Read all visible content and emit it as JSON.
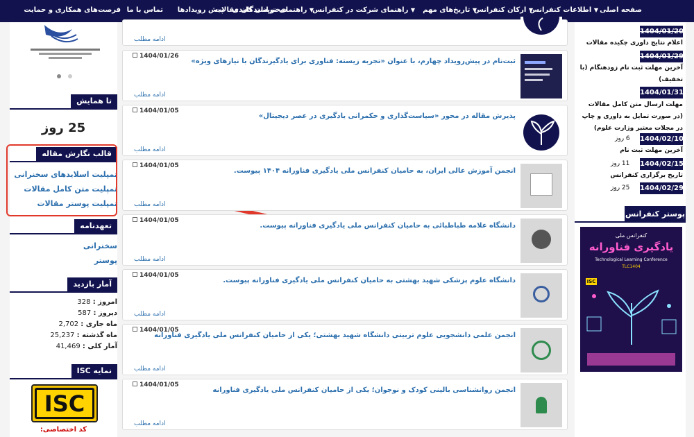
{
  "nav": [
    {
      "label": "صفحه اصلی",
      "dropdown": false
    },
    {
      "label": "اطلاعات کنفرانس",
      "dropdown": true
    },
    {
      "label": "ارکان کنفرانس",
      "dropdown": true
    },
    {
      "label": "تاریخ‌های مهم",
      "dropdown": true
    },
    {
      "label": "راهنمای شرکت در کنفرانس",
      "dropdown": true
    },
    {
      "label": "راهنمای نویسندگان مقالات",
      "dropdown": true
    },
    {
      "label": "سخنرانان کلیدی",
      "dropdown": false
    },
    {
      "label": "پیش رویدادها",
      "dropdown": false
    },
    {
      "label": "تماس با ما",
      "dropdown": false
    },
    {
      "label": "فرصت‌های همکاری و حمایت",
      "dropdown": false
    }
  ],
  "left": {
    "countdown": {
      "title": "تا همایش",
      "value": "25 روز"
    },
    "template": {
      "title": "قالب نگارش مقاله",
      "links": [
        "تمپلیت اسلایدهای سخنرانی",
        "تمپلیت متن کامل مقالات",
        "تمپلیت پوستر مقالات"
      ]
    },
    "commitment": {
      "title": "تعهدنامه",
      "links": [
        "سخنرانی",
        "پوستر"
      ]
    },
    "stats": {
      "title": "آمار بازدید",
      "rows": [
        {
          "label": "امروز :",
          "value": "328"
        },
        {
          "label": "دیروز :",
          "value": "587"
        },
        {
          "label": "ماه جاری :",
          "value": "2,702"
        },
        {
          "label": "ماه گذشته :",
          "value": "25,237"
        },
        {
          "label": "آمار کلی :",
          "value": "41,469"
        }
      ]
    },
    "isc": {
      "title": "نمایه ISC",
      "logo_text": "ISC",
      "code_label": "کد اختصاصی:"
    }
  },
  "news": {
    "more_label": "ادامه مطلب",
    "items": [
      {
        "date": "",
        "title": ""
      },
      {
        "date": "1404/01/26",
        "title": "ثبت‌نام در پیش‌رویداد چهارم، با عنوان «تجربه زیسته: فناوری برای یادگیرندگان با نیازهای ویژه»"
      },
      {
        "date": "1404/01/05",
        "title": "پذیرش مقاله در محور «سیاست‌گذاری و حکمرانی یادگیری در عصر دیجیتال»"
      },
      {
        "date": "1404/01/05",
        "title": "انجمن آموزش عالی ایران، به حامیان کنفرانس ملی یادگیری فناورانه ۱۴۰۴ پیوست."
      },
      {
        "date": "1404/01/05",
        "title": "دانشگاه علامه طباطبائی به حامیان کنفرانس ملی یادگیری فناورانه پیوست."
      },
      {
        "date": "1404/01/05",
        "title": "دانشگاه علوم پزشکی شهید بهشتی به حامیان کنفرانس ملی یادگیری فناورانه پیوست."
      },
      {
        "date": "1404/01/05",
        "title": "انجمن علمی دانشجویی علوم تربیتی دانشگاه شهید بهشتی؛ یکی از حامیان کنفرانس ملی یادگیری فناورانه"
      },
      {
        "date": "1404/01/05",
        "title": "انجمن روانشناسی بالینی کودک و نوجوان؛ یکی از حامیان کنفرانس ملی یادگیری فناورانه"
      }
    ]
  },
  "right": {
    "dates": [
      {
        "date": "1404/01/20",
        "strike": true,
        "label": ""
      },
      {
        "date": "1404/01/29",
        "strike": true,
        "label": "اعلام نتایج داوری چکیده مقالات"
      },
      {
        "date": "1404/01/31",
        "strike": false,
        "label": "آخرین مهلت ثبت نام زودهنگام (با تخفیف)"
      },
      {
        "date": "1404/02/10",
        "strike": false,
        "label": "مهلت ارسال متن کامل مقالات (در صورت تمایل به داوری و چاپ در مجلات معتبر وزارت علوم)",
        "days": "6 روز"
      },
      {
        "date": "1404/02/15",
        "strike": false,
        "label": "آخرین مهلت ثبت نام",
        "days": "11 روز"
      },
      {
        "date": "1404/02/29",
        "strike": false,
        "label": "تاریخ برگزاری کنفرانس",
        "days": "25 روز"
      }
    ],
    "poster": {
      "title": "پوستر کنفرانس",
      "heading": "یادگیری فناورانه",
      "top_line": "کنفرانس ملی",
      "sub": "Technological Learning Conference",
      "code": "TLC1404",
      "isc": "ISC"
    }
  }
}
